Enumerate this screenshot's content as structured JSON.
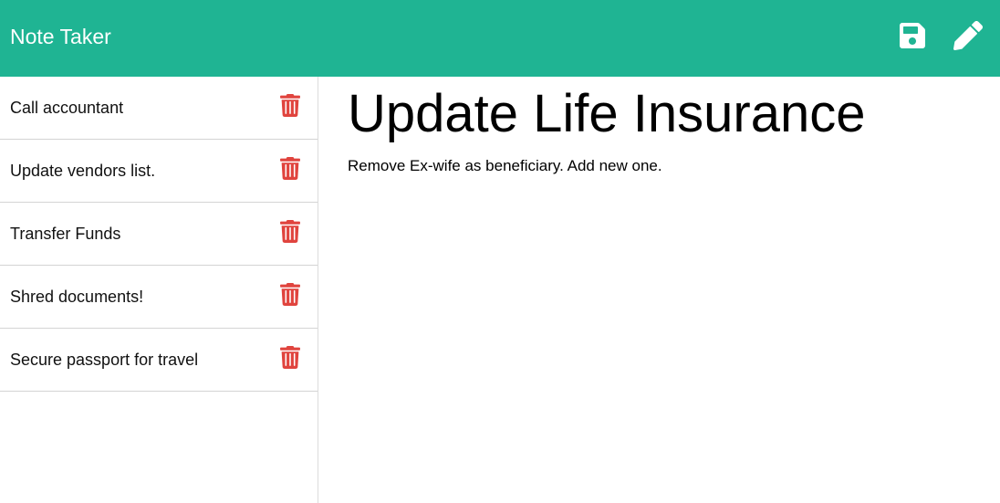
{
  "app": {
    "title": "Note Taker",
    "accent_color": "#1fb493",
    "delete_color": "#e0443e"
  },
  "toolbar": {
    "save_icon": "floppy-disk-icon",
    "new_note_icon": "pencil-icon"
  },
  "notes": [
    {
      "title": "Call accountant",
      "icon": "trash-icon"
    },
    {
      "title": "Update vendors list.",
      "icon": "trash-icon"
    },
    {
      "title": "Transfer Funds",
      "icon": "trash-icon"
    },
    {
      "title": "Shred documents!",
      "icon": "trash-icon"
    },
    {
      "title": "Secure passport for travel",
      "icon": "trash-icon"
    }
  ],
  "active_note": {
    "title": "Update Life Insurance",
    "text": "Remove Ex-wife as beneficiary. Add new one."
  }
}
